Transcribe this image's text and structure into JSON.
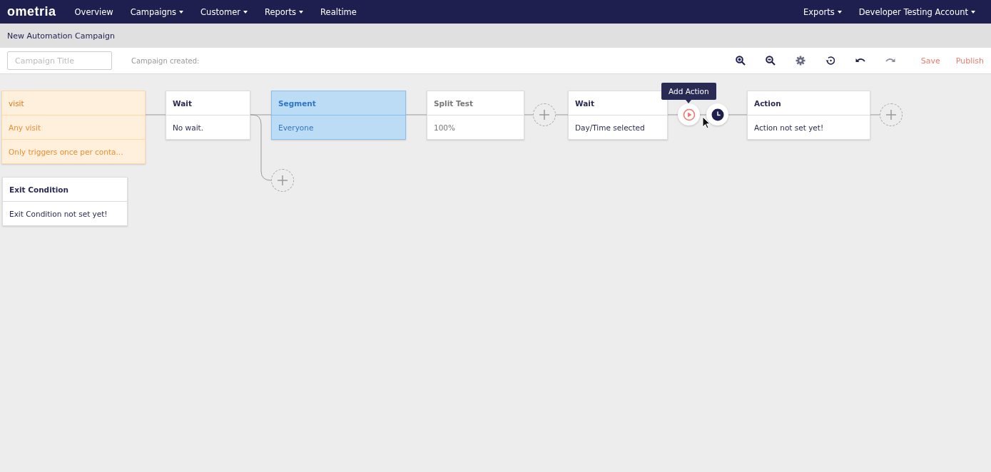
{
  "nav": {
    "logo": "ometria",
    "left": [
      {
        "label": "Overview",
        "dropdown": false
      },
      {
        "label": "Campaigns",
        "dropdown": true
      },
      {
        "label": "Customer",
        "dropdown": true
      },
      {
        "label": "Reports",
        "dropdown": true
      },
      {
        "label": "Realtime",
        "dropdown": false
      }
    ],
    "right": [
      {
        "label": "Exports",
        "dropdown": true
      },
      {
        "label": "Developer Testing Account",
        "dropdown": true
      }
    ]
  },
  "page_title": "New Automation Campaign",
  "toolbar": {
    "title_field": {
      "placeholder": "Campaign Title"
    },
    "created_label": "Campaign created:",
    "save": "Save",
    "publish": "Publish"
  },
  "nodes": [
    {
      "kind": "trigger",
      "title": "visit",
      "lines": [
        "Any visit",
        "Only triggers once per conta..."
      ],
      "selected": false,
      "disabled": false
    },
    {
      "kind": "step",
      "title": "Wait",
      "lines": [
        "No wait."
      ],
      "selected": false,
      "disabled": false
    },
    {
      "kind": "step",
      "title": "Segment",
      "lines": [
        "Everyone"
      ],
      "selected": true,
      "disabled": false
    },
    {
      "kind": "step",
      "title": "Split Test",
      "lines": [
        "100%"
      ],
      "selected": false,
      "disabled": true
    },
    {
      "kind": "step",
      "title": "Wait",
      "lines": [
        "Day/Time selected"
      ],
      "selected": false,
      "disabled": false
    },
    {
      "kind": "step",
      "title": "Action",
      "lines": [
        "Action not set yet!"
      ],
      "selected": false,
      "disabled": false
    },
    {
      "kind": "step",
      "title": "Exit Condition",
      "lines": [
        "Exit Condition not set yet!"
      ],
      "selected": false,
      "disabled": false
    }
  ],
  "tooltip": "Add Action"
}
